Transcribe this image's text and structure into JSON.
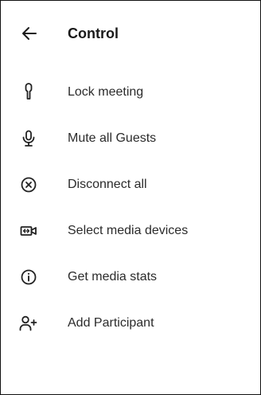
{
  "header": {
    "title": "Control",
    "back_icon": "arrow-left-icon"
  },
  "menu": {
    "items": [
      {
        "label": "Lock meeting",
        "icon": "lock-icon"
      },
      {
        "label": "Mute all Guests",
        "icon": "microphone-icon"
      },
      {
        "label": "Disconnect all",
        "icon": "close-circle-icon"
      },
      {
        "label": "Select media devices",
        "icon": "camera-devices-icon"
      },
      {
        "label": "Get media stats",
        "icon": "info-icon"
      },
      {
        "label": "Add Participant",
        "icon": "add-person-icon"
      }
    ]
  },
  "colors": {
    "text": "#2b2b2b",
    "border": "#111111",
    "background": "#ffffff"
  }
}
